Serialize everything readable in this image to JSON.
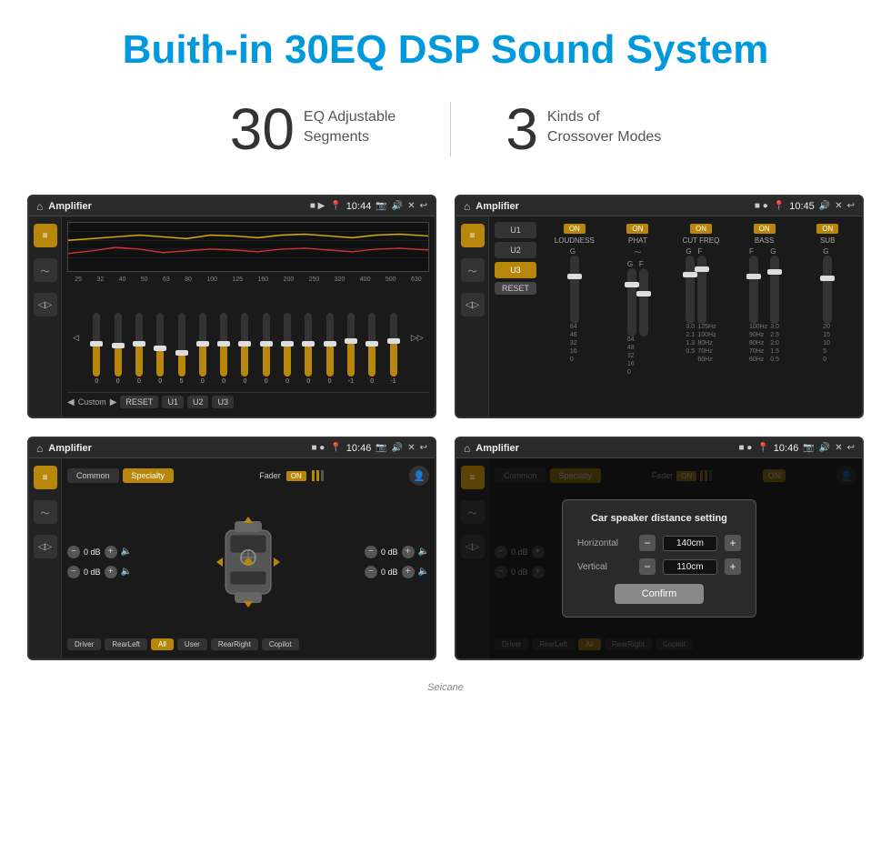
{
  "header": {
    "title": "Buith-in 30EQ DSP Sound System"
  },
  "stats": [
    {
      "number": "30",
      "label": "EQ Adjustable\nSegments"
    },
    {
      "number": "3",
      "label": "Kinds of\nCrossover Modes"
    }
  ],
  "screens": [
    {
      "id": "eq-screen",
      "topbar": {
        "title": "Amplifier",
        "time": "10:44"
      },
      "type": "eq",
      "freqs": [
        "25",
        "32",
        "40",
        "50",
        "63",
        "80",
        "100",
        "125",
        "160",
        "200",
        "250",
        "320",
        "400",
        "500",
        "630"
      ],
      "sliders": [
        50,
        48,
        52,
        55,
        50,
        48,
        55,
        52,
        50,
        48,
        52,
        55,
        49,
        48,
        49
      ],
      "values": [
        "0",
        "0",
        "0",
        "0",
        "5",
        "0",
        "0",
        "0",
        "0",
        "0",
        "0",
        "0",
        "-1",
        "0",
        "-1"
      ],
      "bottomBtns": [
        "Custom",
        "RESET",
        "U1",
        "U2",
        "U3"
      ]
    },
    {
      "id": "crossover-screen",
      "topbar": {
        "title": "Amplifier",
        "time": "10:45"
      },
      "type": "crossover",
      "presets": [
        "U1",
        "U2",
        "U3"
      ],
      "activePreset": "U3",
      "channels": [
        "LOUDNESS",
        "PHAT",
        "CUT FREQ",
        "BASS",
        "SUB"
      ],
      "channelOn": [
        true,
        true,
        true,
        true,
        true
      ],
      "resetLabel": "RESET"
    },
    {
      "id": "specialty-screen",
      "topbar": {
        "title": "Amplifier",
        "time": "10:46"
      },
      "type": "specialty",
      "tabs": [
        "Common",
        "Specialty"
      ],
      "activeTab": "Specialty",
      "faderLabel": "Fader",
      "faderOn": true,
      "volumes": [
        {
          "label": "0 dB",
          "pos": "topLeft"
        },
        {
          "label": "0 dB",
          "pos": "topRight"
        },
        {
          "label": "0 dB",
          "pos": "bottomLeft"
        },
        {
          "label": "0 dB",
          "pos": "bottomRight"
        }
      ],
      "speakerBtns": [
        "Driver",
        "RearLeft",
        "All",
        "User",
        "RearRight",
        "Copilot"
      ]
    },
    {
      "id": "specialty-dialog-screen",
      "topbar": {
        "title": "Amplifier",
        "time": "10:46"
      },
      "type": "specialty-dialog",
      "tabs": [
        "Common",
        "Specialty"
      ],
      "activeTab": "Specialty",
      "dialog": {
        "title": "Car speaker distance setting",
        "fields": [
          {
            "label": "Horizontal",
            "value": "140cm"
          },
          {
            "label": "Vertical",
            "value": "110cm"
          }
        ],
        "confirmLabel": "Confirm"
      },
      "volumes": [
        {
          "label": "0 dB"
        },
        {
          "label": "0 dB"
        }
      ],
      "speakerBtns": [
        "Driver",
        "RearLeft",
        "All",
        "RearRight",
        "Copilot"
      ]
    }
  ],
  "watermark": "Seicane",
  "colors": {
    "accent": "#b8860b",
    "bg_dark": "#1a1a1a",
    "title_blue": "#0099dd"
  }
}
